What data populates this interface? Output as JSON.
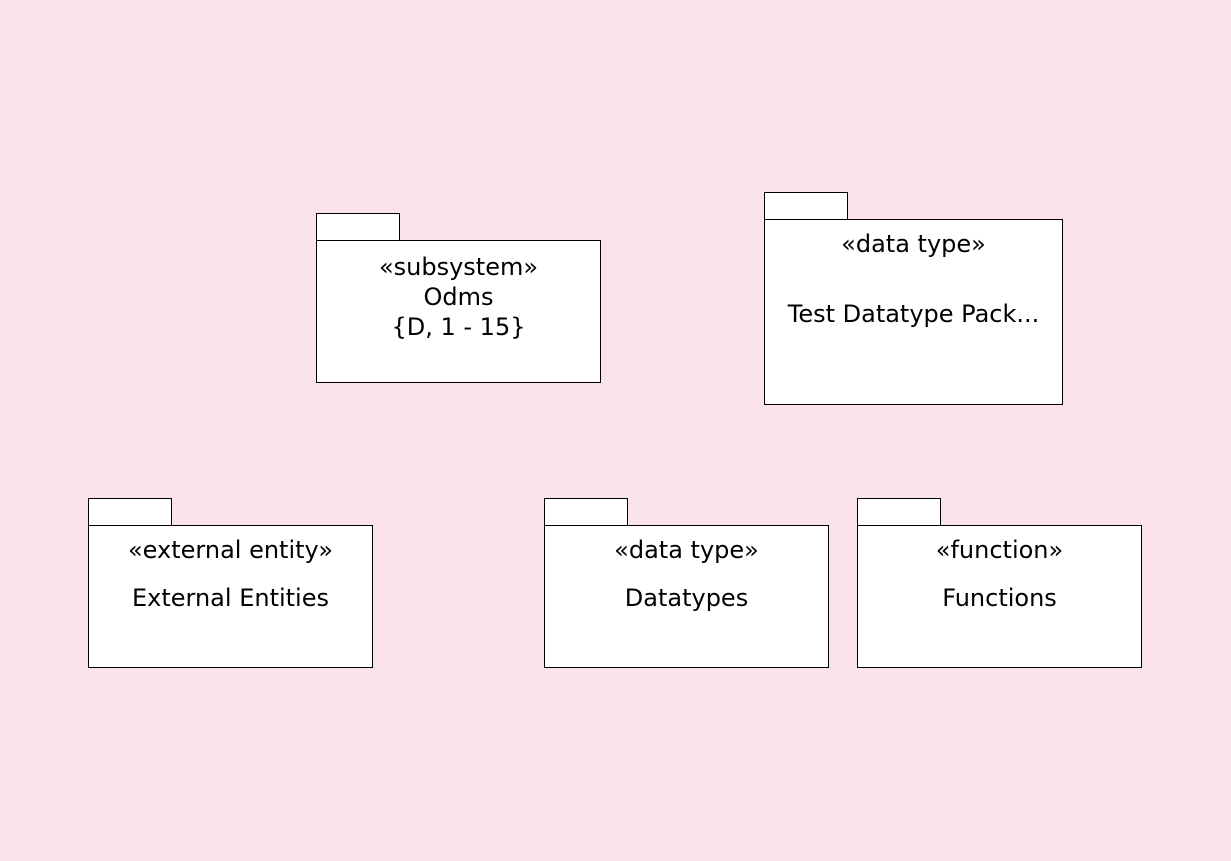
{
  "colors": {
    "background": "#f9e2e8",
    "package_fill": "#ffffff",
    "package_border": "#000000"
  },
  "packages": [
    {
      "stereotype": "«subsystem»",
      "name": "Odms",
      "detail": "{D, 1 - 15}"
    },
    {
      "stereotype": "«data type»",
      "name": "Test Datatype Pack..."
    },
    {
      "stereotype": "«external entity»",
      "name": "External Entities"
    },
    {
      "stereotype": "«data type»",
      "name": "Datatypes"
    },
    {
      "stereotype": "«function»",
      "name": "Functions"
    }
  ]
}
